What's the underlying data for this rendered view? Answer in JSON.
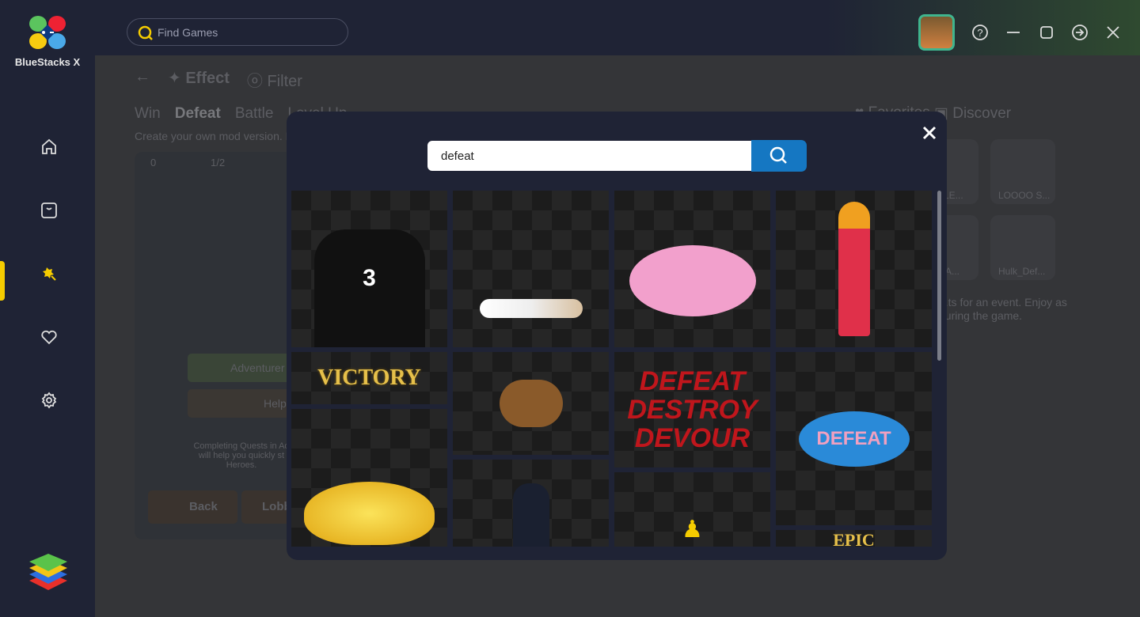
{
  "app": {
    "name": "BlueStacks X"
  },
  "topbar": {
    "search_placeholder": "Find Games"
  },
  "sidebar": {
    "items": [
      {
        "icon": "home-icon"
      },
      {
        "icon": "store-icon"
      },
      {
        "icon": "effect-icon",
        "active": true
      },
      {
        "icon": "heart-icon"
      },
      {
        "icon": "gear-icon"
      }
    ]
  },
  "background": {
    "header": {
      "effect": "Effect",
      "filter": "Filter"
    },
    "tabs": [
      "Win",
      "Defeat",
      "Battle",
      "Level Up"
    ],
    "subtitle": "Create your own mod version. F",
    "stats": [
      "0",
      "1/2"
    ],
    "right_tabs": {
      "favorites": "Favorites",
      "discover": "Discover"
    },
    "cards": [
      "...ELE...",
      "LOOOO S...",
      "...MA...",
      "Hulk_Def..."
    ],
    "right_text": [
      "...ts for an event. Enjoy as",
      "during the game."
    ],
    "game": {
      "adventurer": "Adventurer",
      "help": "Help",
      "quest_text": [
        "Completing Quests in Ad",
        "will help you quickly st",
        "Heroes."
      ],
      "back": "Back",
      "lobby": "Lobb"
    }
  },
  "modal": {
    "search_value": "defeat",
    "results": {
      "victory": "VICTORY",
      "ddd": [
        "DEFEAT",
        "DESTROY",
        "DEVOUR"
      ],
      "defeat": "DEFEAT",
      "epic": "EPIC",
      "jersey": "3"
    }
  },
  "colors": {
    "accent": "#f5cc00",
    "search_button": "#1577c2",
    "modal_bg": "#1f2335"
  }
}
